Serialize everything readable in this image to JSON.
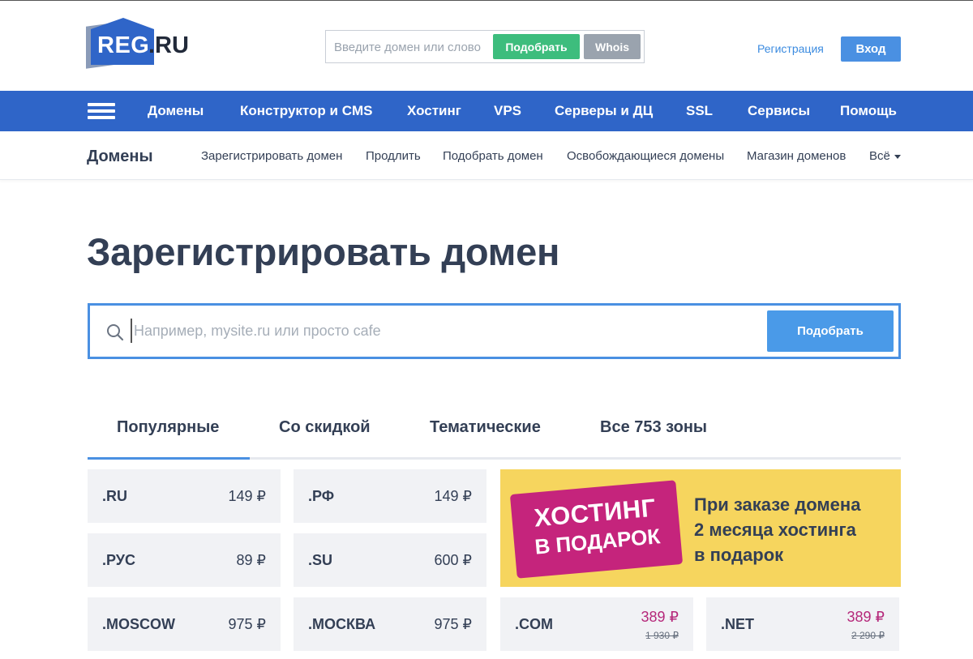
{
  "header": {
    "logo_text_reg": "REG",
    "logo_text_ru": ".RU",
    "search_placeholder": "Введите домен или слово",
    "pick_button": "Подобрать",
    "whois_button": "Whois",
    "register_link": "Регистрация",
    "login_button": "Вход"
  },
  "mainnav": {
    "items": [
      "Домены",
      "Конструктор и CMS",
      "Хостинг",
      "VPS",
      "Серверы и ДЦ",
      "SSL",
      "Сервисы",
      "Помощь"
    ]
  },
  "subnav": {
    "title": "Домены",
    "items": [
      "Зарегистрировать домен",
      "Продлить",
      "Подобрать домен",
      "Освобождающиеся домены",
      "Магазин доменов",
      "Всё"
    ]
  },
  "page": {
    "title": "Зарегистрировать домен"
  },
  "search": {
    "placeholder": "Например, mysite.ru или просто cafe",
    "button": "Подобрать"
  },
  "tabs": [
    "Популярные",
    "Со скидкой",
    "Тематические",
    "Все 753 зоны"
  ],
  "active_tab": "Популярные",
  "domains": [
    {
      "zone": ".RU",
      "price": "149 ₽"
    },
    {
      "zone": ".РФ",
      "price": "149 ₽"
    },
    {
      "zone": ".РУС",
      "price": "89 ₽"
    },
    {
      "zone": ".SU",
      "price": "600 ₽"
    },
    {
      "zone": ".MOSCOW",
      "price": "975 ₽"
    },
    {
      "zone": ".МОСКВА",
      "price": "975 ₽"
    },
    {
      "zone": ".COM",
      "price": "389 ₽",
      "old_price": "1 930 ₽"
    },
    {
      "zone": ".NET",
      "price": "389 ₽",
      "old_price": "2 290 ₽"
    }
  ],
  "promo": {
    "stamp_line1": "ХОСТИНГ",
    "stamp_line2": "В ПОДАРОК",
    "text_lines": [
      "При заказе домена",
      "2 месяца хостинга",
      "в подарок"
    ]
  },
  "colors": {
    "brand_blue": "#2f65c8",
    "accent_blue": "#4a90e2",
    "green": "#3dbd7d",
    "sale_magenta": "#b5287a",
    "promo_yellow": "#f6d55e"
  }
}
